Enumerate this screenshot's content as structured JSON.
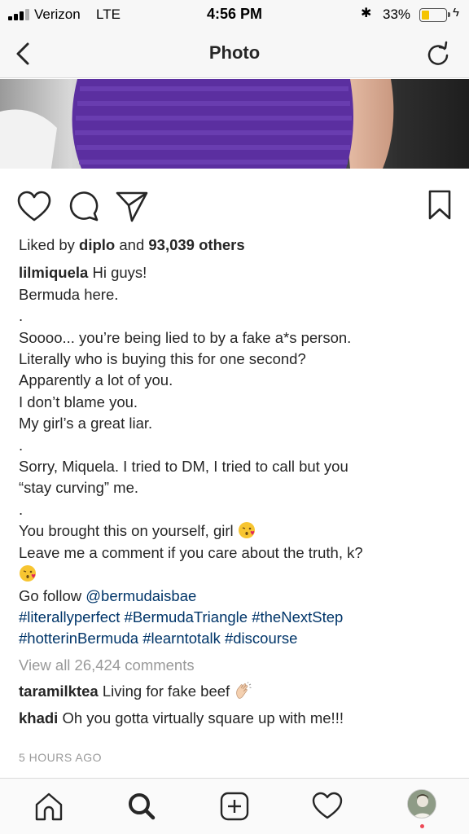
{
  "status_bar": {
    "carrier": "Verizon",
    "network": "LTE",
    "time": "4:56 PM",
    "battery_percent": "33%",
    "battery_level": 0.33
  },
  "nav": {
    "title": "Photo"
  },
  "post": {
    "likes": {
      "prefix": "Liked by ",
      "user": "diplo",
      "middle": " and ",
      "count": "93,039 others"
    },
    "author": "lilmiquela",
    "caption_lines": [
      "Hi guys!",
      "Bermuda here.",
      ".",
      "Soooo... you’re being lied to by a fake a*s person.",
      "Literally who is buying this for one second?",
      "Apparently a lot of you.",
      "I don’t blame you.",
      "My girl’s a great liar.",
      ".",
      "Sorry, Miquela. I tried to DM, I tried to call but you",
      "“stay curving” me.",
      ".",
      "You brought this on yourself, girl",
      "Leave me a comment if you care about the truth, k?"
    ],
    "follow_prefix": "Go follow ",
    "follow_handle": "@bermudaisbae",
    "hashtags_line1": "#literallyperfect #BermudaTriangle #theNextStep",
    "hashtags_line2": "#hotterinBermuda #learntotalk #discourse",
    "view_comments": "View all 26,424 comments",
    "comments": [
      {
        "user": "taramilktea",
        "text": "Living for fake beef"
      },
      {
        "user": "khadi",
        "text": "Oh you gotta virtually square up with me!!!"
      }
    ],
    "timestamp": "5 HOURS AGO"
  },
  "icons": {
    "back": "chevron-left-icon",
    "refresh": "refresh-icon",
    "like": "heart-icon",
    "comment": "comment-icon",
    "share": "send-icon",
    "save": "bookmark-icon",
    "home": "home-icon",
    "search": "search-icon",
    "new_post": "add-post-icon",
    "activity": "heart-icon",
    "profile": "avatar"
  },
  "colors": {
    "link": "#003569",
    "muted": "#999999",
    "battery": "#f5c400",
    "notification": "#ed4956"
  }
}
